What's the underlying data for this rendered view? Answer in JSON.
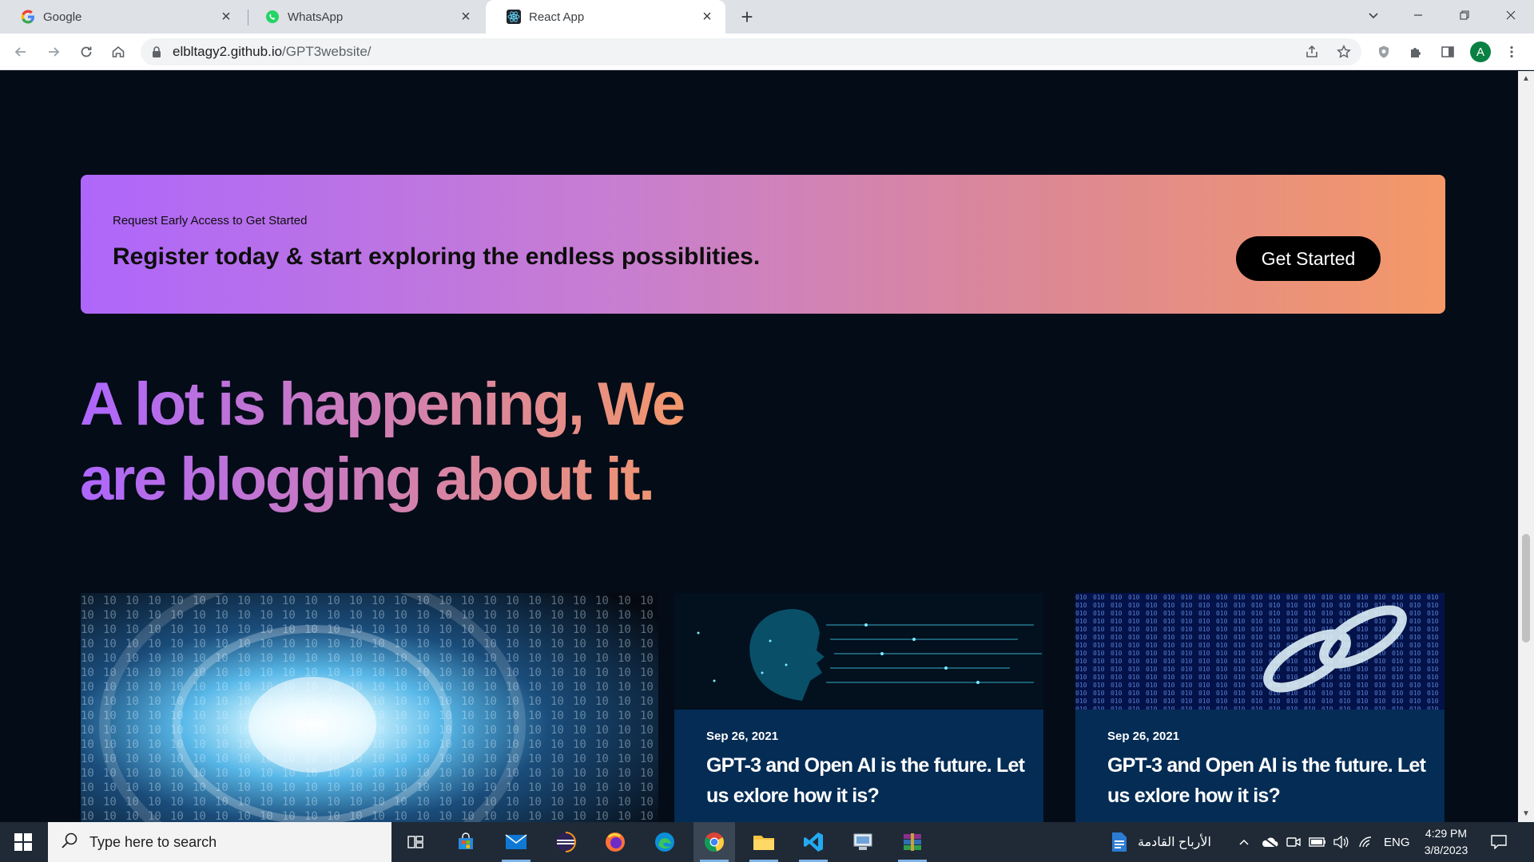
{
  "browser": {
    "tabs": [
      {
        "title": "Google",
        "icon": "google-icon"
      },
      {
        "title": "WhatsApp",
        "icon": "whatsapp-icon"
      },
      {
        "title": "React App",
        "icon": "react-icon",
        "active": true
      }
    ],
    "url_host": "elbltagy2.github.io",
    "url_path": "/GPT3website/",
    "profile_initial": "A"
  },
  "cta": {
    "subtitle": "Request Early Access to Get Started",
    "title": "Register today & start exploring the endless possiblities.",
    "button_label": "Get Started",
    "gradient": [
      "#AE67FA",
      "#F49867"
    ]
  },
  "blog": {
    "heading_line1": "A lot is happening, We",
    "heading_line2": "are blogging about it.",
    "posts": [
      {
        "date": "Sep 26, 2021",
        "title": "GPT-3 and Open AI is the future. Let us exlore how it is?"
      },
      {
        "date": "Sep 26, 2021",
        "title": "GPT-3 and Open AI is the future. Let us exlore how it is?"
      }
    ]
  },
  "taskbar": {
    "search_placeholder": "Type here to search",
    "weather_text": "الأرباح القادمة",
    "language": "ENG",
    "time": "4:29 PM",
    "date": "3/8/2023"
  },
  "colors": {
    "page_bg": "#040C18",
    "card_bg": "#042C54",
    "accent_start": "#AE67FA",
    "accent_end": "#F49867"
  }
}
